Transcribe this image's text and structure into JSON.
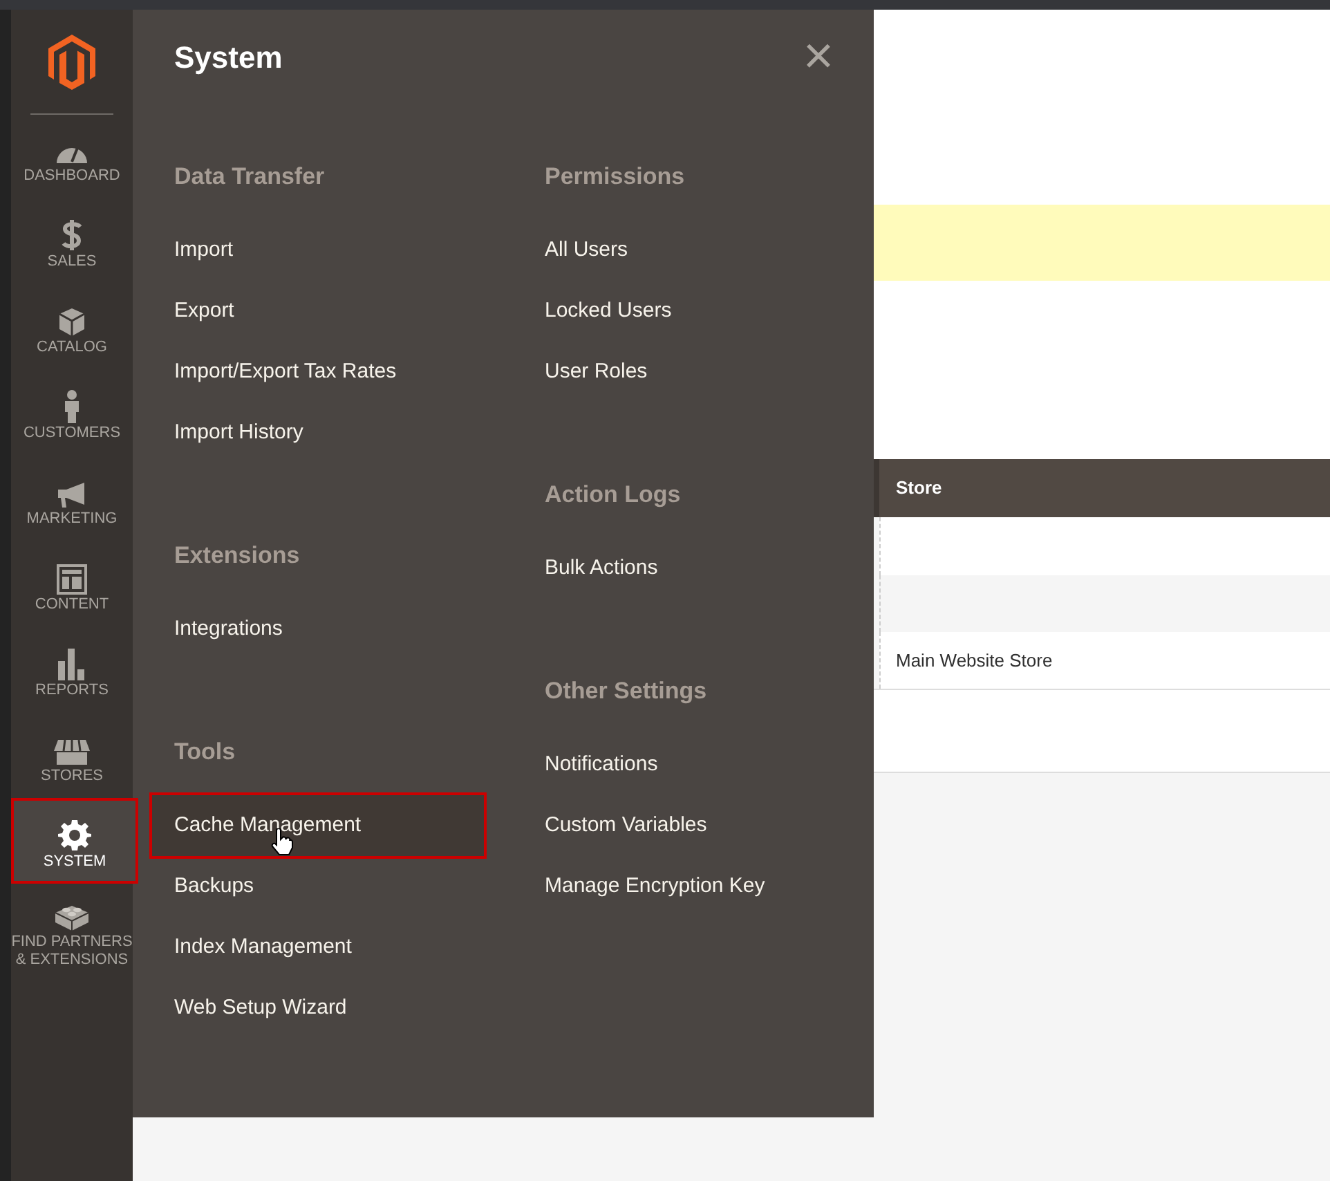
{
  "sidebar": {
    "items": [
      {
        "label": "DASHBOARD",
        "selected": false
      },
      {
        "label": "SALES",
        "selected": false
      },
      {
        "label": "CATALOG",
        "selected": false
      },
      {
        "label": "CUSTOMERS",
        "selected": false
      },
      {
        "label": "MARKETING",
        "selected": false
      },
      {
        "label": "CONTENT",
        "selected": false
      },
      {
        "label": "REPORTS",
        "selected": false
      },
      {
        "label": "STORES",
        "selected": false
      },
      {
        "label": "SYSTEM",
        "selected": true
      },
      {
        "label": "FIND PARTNERS & EXTENSIONS",
        "selected": false
      }
    ]
  },
  "menu": {
    "title": "System",
    "close": "×",
    "columns": [
      [
        {
          "heading": "Data Transfer",
          "items": [
            {
              "label": "Import",
              "selected": false
            },
            {
              "label": "Export",
              "selected": false
            },
            {
              "label": "Import/Export Tax Rates",
              "selected": false
            },
            {
              "label": "Import History",
              "selected": false
            }
          ]
        },
        {
          "heading": "Extensions",
          "items": [
            {
              "label": "Integrations",
              "selected": false
            }
          ]
        },
        {
          "heading": "Tools",
          "items": [
            {
              "label": "Cache Management",
              "selected": true
            },
            {
              "label": "Backups",
              "selected": false
            },
            {
              "label": "Index Management",
              "selected": false
            },
            {
              "label": "Web Setup Wizard",
              "selected": false
            }
          ]
        }
      ],
      [
        {
          "heading": "Permissions",
          "items": [
            {
              "label": "All Users",
              "selected": false
            },
            {
              "label": "Locked Users",
              "selected": false
            },
            {
              "label": "User Roles",
              "selected": false
            }
          ]
        },
        {
          "heading": "Action Logs",
          "items": [
            {
              "label": "Bulk Actions",
              "selected": false
            }
          ]
        },
        {
          "heading": "Other Settings",
          "items": [
            {
              "label": "Notifications",
              "selected": false
            },
            {
              "label": "Custom Variables",
              "selected": false
            },
            {
              "label": "Manage Encryption Key",
              "selected": false
            }
          ]
        }
      ]
    ]
  },
  "table": {
    "columns": [
      "Store"
    ],
    "rows": [
      {
        "store": "Main Website Store"
      }
    ]
  }
}
